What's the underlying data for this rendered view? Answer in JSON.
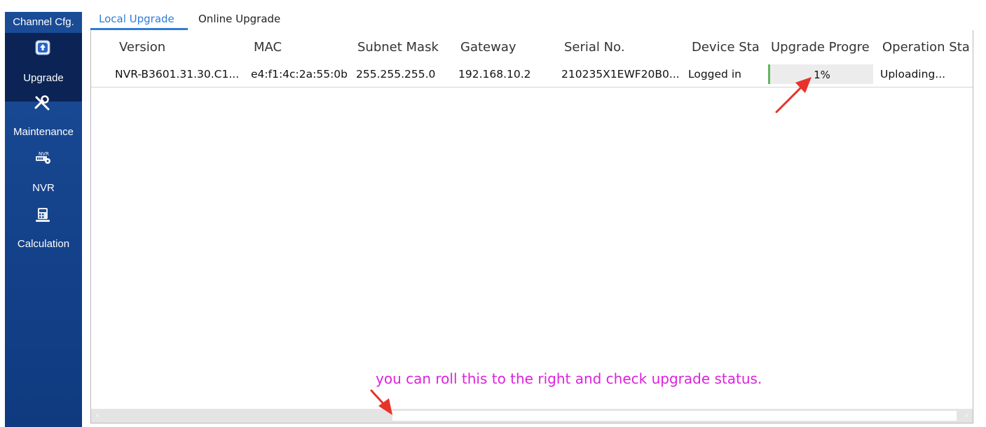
{
  "sidebar": {
    "items": [
      {
        "label": "Channel Cfg.",
        "icon": "channel-cfg-icon"
      },
      {
        "label": "Upgrade",
        "icon": "upgrade-icon",
        "active": true
      },
      {
        "label": "Maintenance",
        "icon": "tools-icon"
      },
      {
        "label": "NVR",
        "icon": "nvr-icon",
        "icon_text": "NVR"
      },
      {
        "label": "Calculation",
        "icon": "calculator-icon"
      }
    ]
  },
  "tabs": [
    {
      "label": "Local Upgrade",
      "active": true
    },
    {
      "label": "Online Upgrade",
      "active": false
    }
  ],
  "table": {
    "columns": [
      "Version",
      "MAC",
      "Subnet Mask",
      "Gateway",
      "Serial No.",
      "Device Sta",
      "Upgrade Progre",
      "Operation Sta"
    ],
    "rows": [
      {
        "version": "NVR-B3601.31.30.C1...",
        "mac": "e4:f1:4c:2a:55:0b",
        "subnet_mask": "255.255.255.0",
        "gateway": "192.168.10.2",
        "serial_no": "210235X1EWF20B0...",
        "device_status": "Logged in",
        "upgrade_progress_label": "1%",
        "upgrade_progress_value": 1,
        "operation_status": "Uploading..."
      }
    ]
  },
  "annotation": {
    "text": "you can roll this to the right and check upgrade status.",
    "color": "#dd22dd",
    "arrow_color": "#e8332a"
  },
  "scrollbar": {
    "left_arrow": "‹",
    "right_arrow": "›"
  },
  "colors": {
    "sidebar_bg": "#1a4c97",
    "sidebar_active_bg": "#0b2455",
    "accent": "#2f7cd6",
    "progress_green": "#5fb75f"
  }
}
